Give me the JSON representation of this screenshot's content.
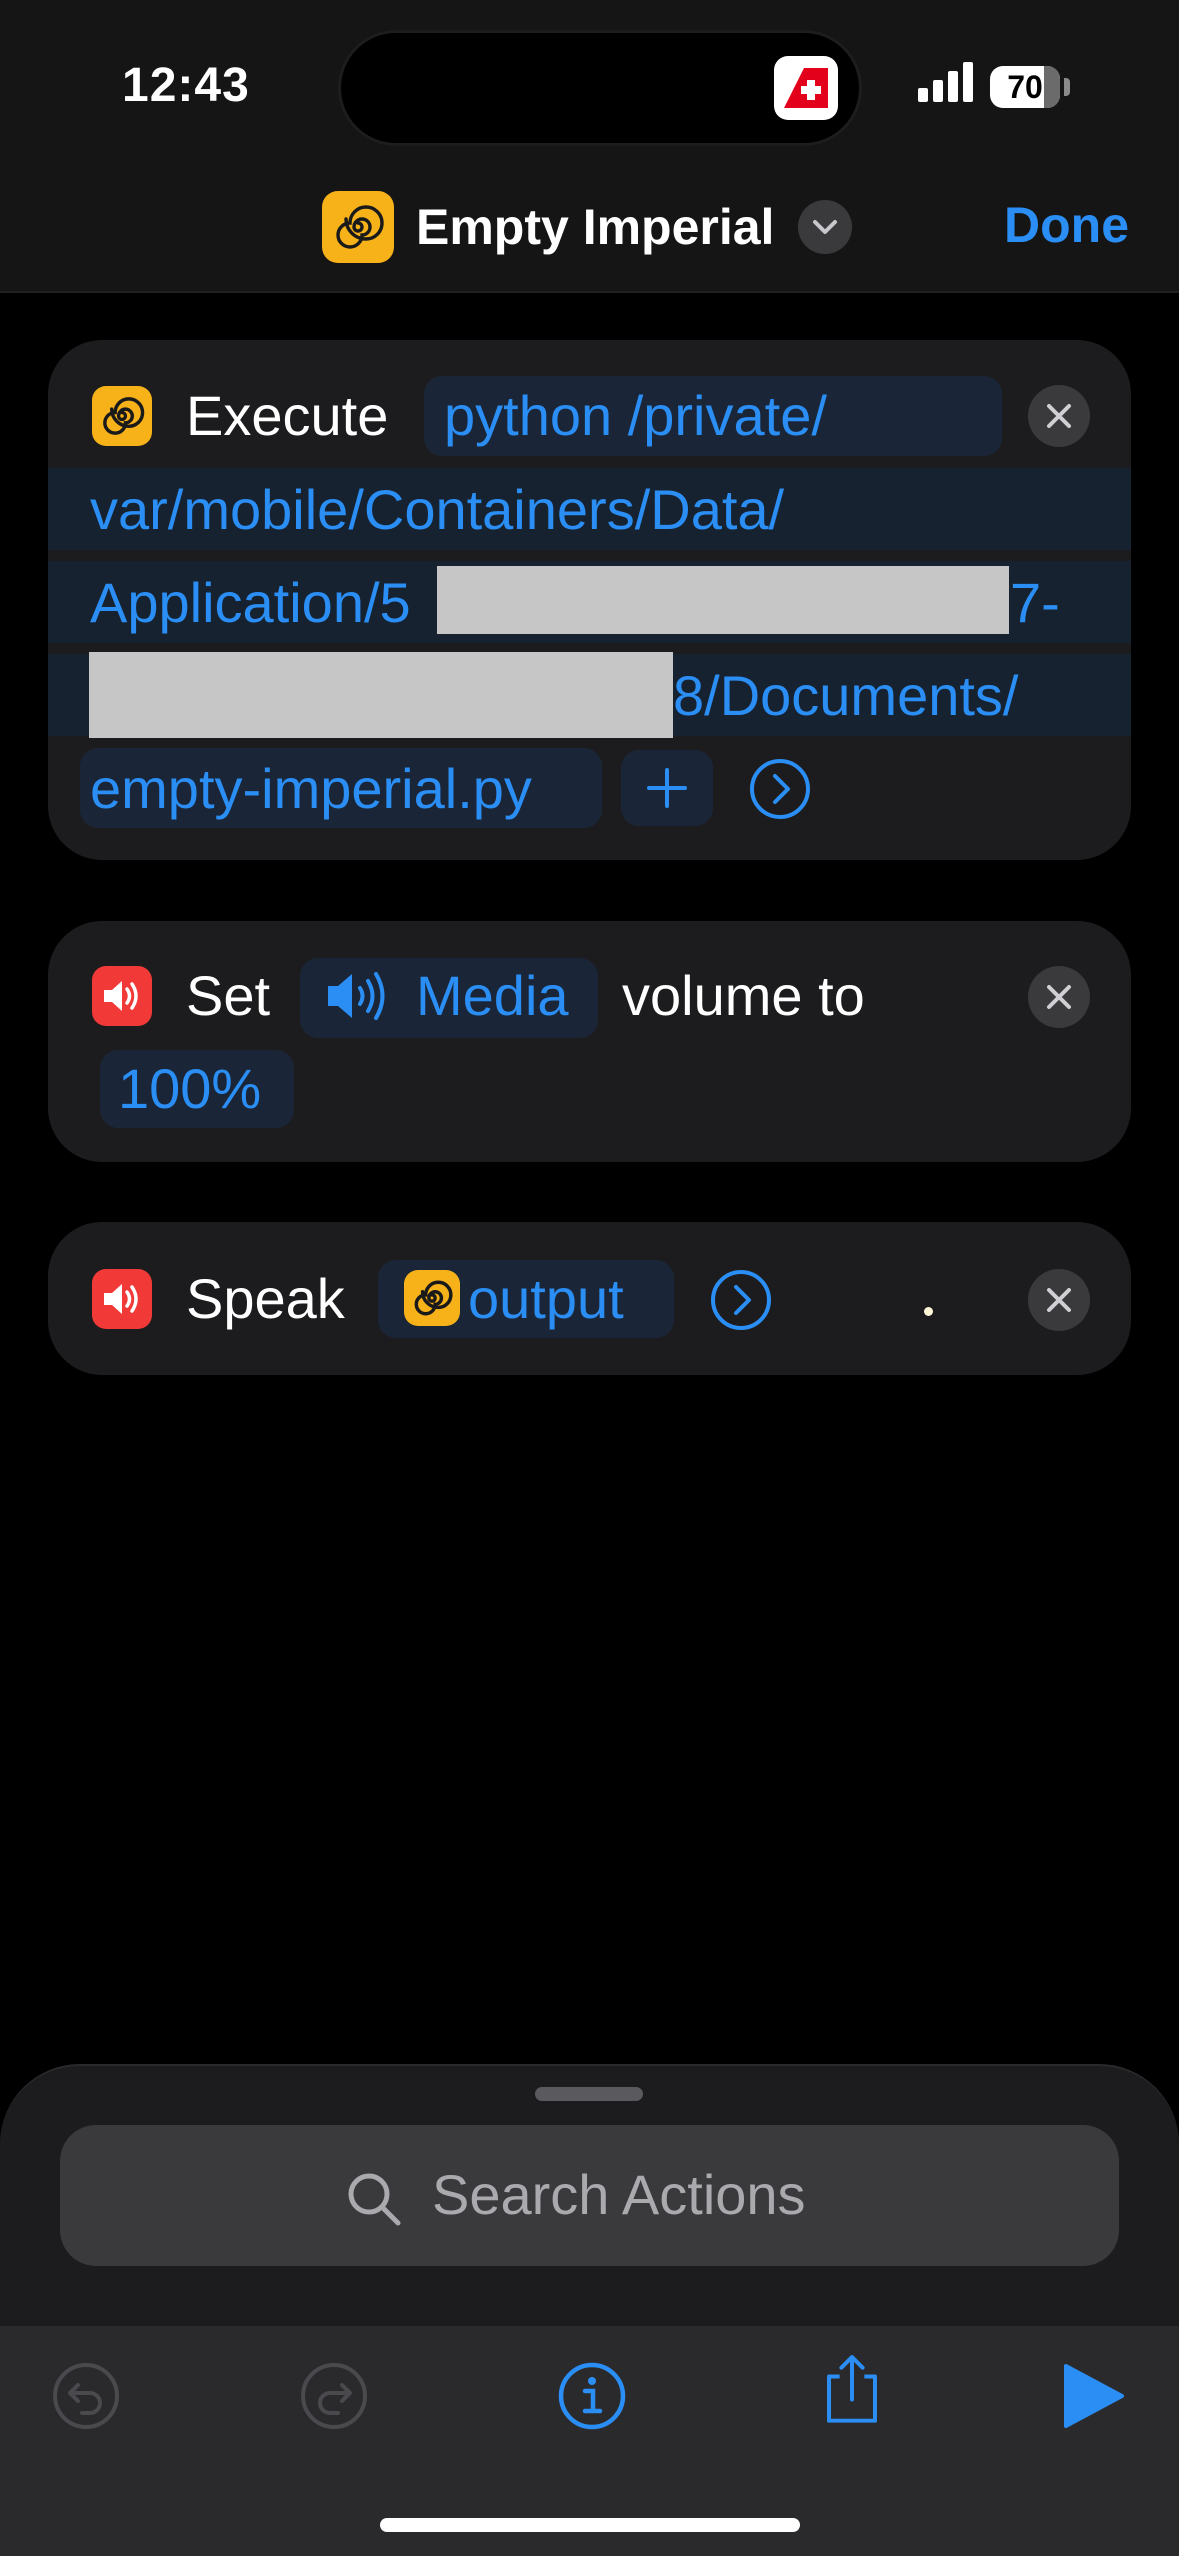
{
  "status_bar": {
    "time": "12:43",
    "battery": "70",
    "island_app_icon": "swiss-app-icon",
    "signal_icon": "cellular-signal-icon"
  },
  "nav": {
    "title": "Empty Imperial",
    "icon": "spiral-icon",
    "done_label": "Done"
  },
  "actions": [
    {
      "verb": "Execute",
      "icon": "spiral-icon",
      "command_lines": [
        "python  /private/",
        "var/mobile/Containers/Data/",
        "Application/5",
        "7-",
        "8/Documents/",
        "empty-imperial.py"
      ]
    },
    {
      "verb": "Set",
      "icon": "speaker-icon",
      "target": "Media",
      "mid_text": "volume to",
      "value": "100%"
    },
    {
      "verb": "Speak",
      "icon": "speaker-icon",
      "input": "output"
    }
  ],
  "search": {
    "placeholder": "Search Actions"
  },
  "toolbar": {
    "buttons": [
      "undo-icon",
      "redo-icon",
      "info-icon",
      "share-icon",
      "play-icon"
    ]
  },
  "colors": {
    "accent": "#2a8ef5",
    "card": "#1c1c1e",
    "token_bg": "#1a2637",
    "shortcut_yellow": "#f7b21a",
    "speaker_red": "#f13a38"
  }
}
